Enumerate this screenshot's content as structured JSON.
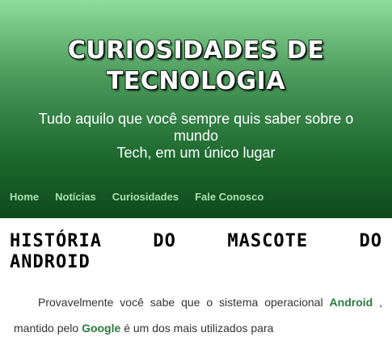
{
  "header": {
    "title_line1": "CURIOSIDADES DE",
    "title_line2": "TECNOLOGIA",
    "tagline_line1": "Tudo aquilo que você sempre quis saber sobre o",
    "tagline_line2": "mundo",
    "tagline_line3": "Tech, em um único lugar"
  },
  "nav": {
    "items": [
      {
        "label": "Home"
      },
      {
        "label": "Notícias"
      },
      {
        "label": "Curiosidades"
      },
      {
        "label": "Fale Conosco"
      }
    ]
  },
  "article": {
    "title_words": [
      "História",
      "do",
      "mascote",
      "do"
    ],
    "title_line2": "Android",
    "p_before_android": "Provavelmente você sabe que o sistema operacional",
    "android": "Android",
    "p_middle": ", mantido pelo",
    "google": "Google",
    "p_after": "é um dos mais utilizados para"
  },
  "colors": {
    "header_top": "#8fdc9c",
    "header_bottom": "#0e4a1c",
    "nav_link": "#a6e0ad",
    "highlight": "#2a7a3b"
  }
}
